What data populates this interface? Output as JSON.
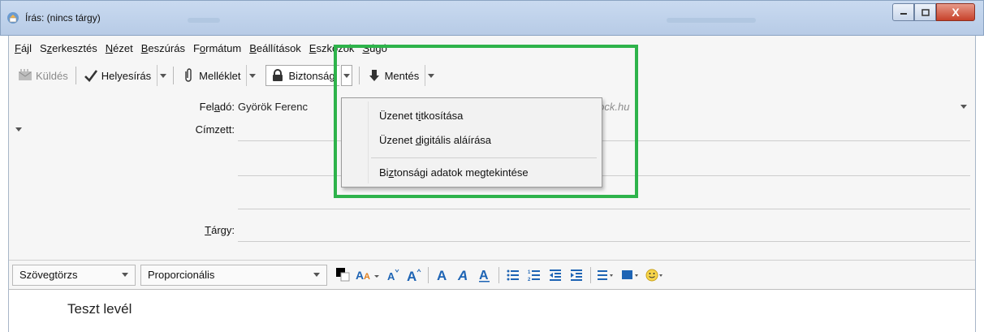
{
  "window": {
    "title": "Írás: (nincs tárgy)",
    "controls": {
      "minimize_icon": "minimize-icon",
      "maximize_icon": "maximize-icon",
      "close_label": "X"
    }
  },
  "menubar": [
    {
      "pre": "",
      "ul": "F",
      "post": "ájl"
    },
    {
      "pre": "S",
      "ul": "z",
      "post": "erkesztés"
    },
    {
      "pre": "",
      "ul": "N",
      "post": "ézet"
    },
    {
      "pre": "",
      "ul": "B",
      "post": "eszúrás"
    },
    {
      "pre": "F",
      "ul": "o",
      "post": "rmátum"
    },
    {
      "pre": "",
      "ul": "B",
      "post": "eállítások"
    },
    {
      "pre": "",
      "ul": "E",
      "post": "szközök"
    },
    {
      "pre": "",
      "ul": "S",
      "post": "úgó"
    }
  ],
  "toolbar": {
    "send_label": "Küldés",
    "spell_label": "Helyesírás",
    "attach_label": "Melléklet",
    "security_label": "Biztonság",
    "save_label": "Mentés"
  },
  "header": {
    "from_label_pre": "Fel",
    "from_label_ul": "a",
    "from_label_post": "dó:",
    "from_name": "Györök Ferenc",
    "from_email": "@netlock.hu",
    "to_label": "Címzett:",
    "subject_label_ul": "T",
    "subject_label_post": "árgy:"
  },
  "security_menu": {
    "encrypt": {
      "pre": "Üzenet t",
      "ul": "i",
      "post": "tkosítása"
    },
    "sign": {
      "pre": "Üzenet ",
      "ul": "d",
      "post": "igitális aláírása"
    },
    "view": {
      "pre": "Bi",
      "ul": "z",
      "post": "tonsági adatok megtekintése"
    }
  },
  "formatbar": {
    "paragraph_style": "Szövegtörzs",
    "font": "Proporcionális",
    "text_color": "#000000"
  },
  "body": {
    "text": "Teszt levél"
  },
  "colors": {
    "highlight": "#2eb34b",
    "format_icons": "#1e64b4"
  }
}
